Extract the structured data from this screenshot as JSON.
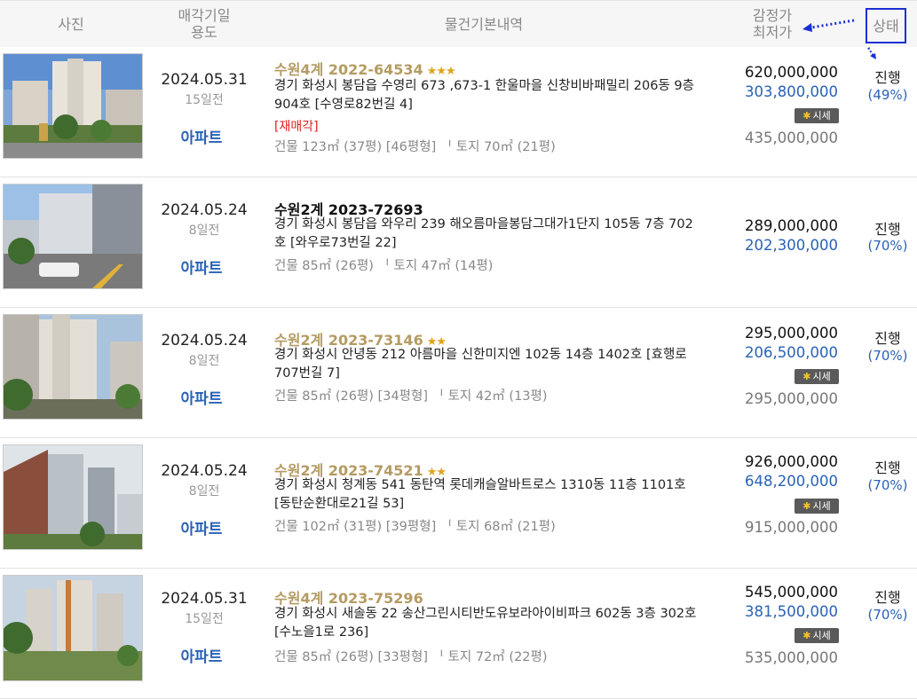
{
  "header": {
    "photo": "사진",
    "date_line1": "매각기일",
    "date_line2": "용도",
    "details": "물건기본내역",
    "price_line1": "감정가",
    "price_line2": "최저가",
    "status": "상태"
  },
  "market_label": "시세",
  "rows": [
    {
      "date": "2024.05.31",
      "days_left": "15일전",
      "type": "아파트",
      "case_no": "수원4계 2022-64534",
      "stars": "★★★",
      "address": "경기 화성시 봉담읍 수영리 673 ,673-1 한울마을 신창비바패밀리 206동 9층 904호 [수영로82번길 4]",
      "resale": "[재매각]",
      "area": "건물 123㎡ (37평) [46평형]  ᅵ  토지 70㎡ (21평)",
      "appraised": "620,000,000",
      "min_price": "303,800,000",
      "sale_price": "435,000,000",
      "status": "진행",
      "percent": "(49%)"
    },
    {
      "date": "2024.05.24",
      "days_left": "8일전",
      "type": "아파트",
      "case_no": "수원2계 2023-72693",
      "stars": "",
      "address": "경기 화성시 봉담읍 와우리 239 해오름마을봉담그대가1단지 105동 7층 702호 [와우로73번길 22]",
      "area": "건물 85㎡ (26평)  ᅵ  토지 47㎡ (14평)",
      "appraised": "289,000,000",
      "min_price": "202,300,000",
      "status": "진행",
      "percent": "(70%)"
    },
    {
      "date": "2024.05.24",
      "days_left": "8일전",
      "type": "아파트",
      "case_no": "수원2계 2023-73146",
      "stars": "★★",
      "address": "경기 화성시 안녕동 212 아름마을 신한미지엔 102동 14층 1402호 [효행로707번길 7]",
      "area": "건물 85㎡ (26평) [34평형]  ᅵ  토지 42㎡ (13평)",
      "appraised": "295,000,000",
      "min_price": "206,500,000",
      "sale_price": "295,000,000",
      "status": "진행",
      "percent": "(70%)"
    },
    {
      "date": "2024.05.24",
      "days_left": "8일전",
      "type": "아파트",
      "case_no": "수원2계 2023-74521",
      "stars": "★★",
      "address": "경기 화성시 청계동 541 동탄역 롯데캐슬알바트로스 1310동 11층 1101호 [동탄순환대로21길 53]",
      "area": "건물 102㎡ (31평) [39평형]  ᅵ  토지 68㎡ (21평)",
      "appraised": "926,000,000",
      "min_price": "648,200,000",
      "sale_price": "915,000,000",
      "status": "진행",
      "percent": "(70%)"
    },
    {
      "date": "2024.05.31",
      "days_left": "15일전",
      "type": "아파트",
      "case_no": "수원4계 2023-75296",
      "stars": "",
      "address": "경기 화성시 새솔동 22 송산그린시티반도유보라아이비파크 602동 3층 302호 [수노을1로 236]",
      "area": "건물 85㎡ (26평) [33평형]  ᅵ  토지 72㎡ (22평)",
      "appraised": "545,000,000",
      "min_price": "381,500,000",
      "sale_price": "535,000,000",
      "status": "진행",
      "percent": "(70%)"
    }
  ]
}
